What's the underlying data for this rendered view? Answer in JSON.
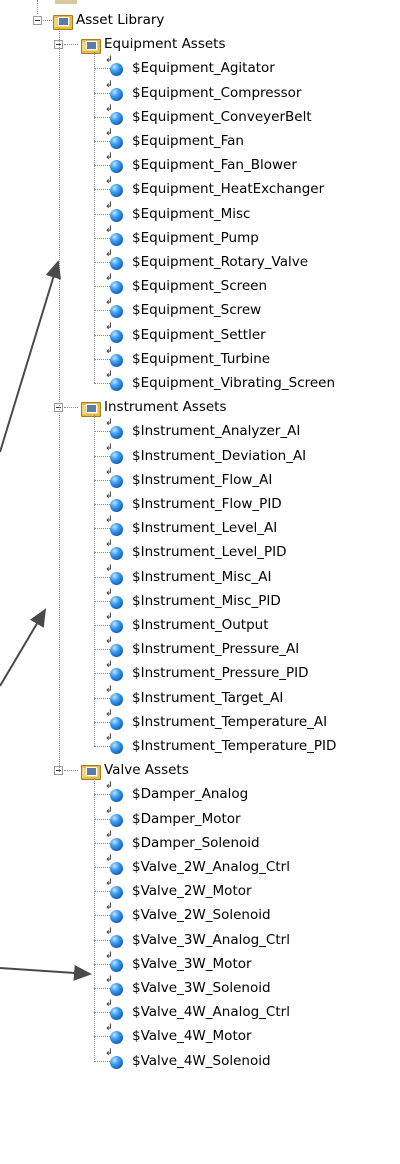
{
  "tree": {
    "root": {
      "label": "Asset Library"
    },
    "groups": [
      {
        "label": "Equipment Assets",
        "items": [
          "$Equipment_Agitator",
          "$Equipment_Compressor",
          "$Equipment_ConveyerBelt",
          "$Equipment_Fan",
          "$Equipment_Fan_Blower",
          "$Equipment_HeatExchanger",
          "$Equipment_Misc",
          "$Equipment_Pump",
          "$Equipment_Rotary_Valve",
          "$Equipment_Screen",
          "$Equipment_Screw",
          "$Equipment_Settler",
          "$Equipment_Turbine",
          "$Equipment_Vibrating_Screen"
        ]
      },
      {
        "label": "Instrument Assets",
        "items": [
          "$Instrument_Analyzer_AI",
          "$Instrument_Deviation_AI",
          "$Instrument_Flow_AI",
          "$Instrument_Flow_PID",
          "$Instrument_Level_AI",
          "$Instrument_Level_PID",
          "$Instrument_Misc_AI",
          "$Instrument_Misc_PID",
          "$Instrument_Output",
          "$Instrument_Pressure_AI",
          "$Instrument_Pressure_PID",
          "$Instrument_Target_AI",
          "$Instrument_Temperature_AI",
          "$Instrument_Temperature_PID"
        ]
      },
      {
        "label": "Valve Assets",
        "items": [
          "$Damper_Analog",
          "$Damper_Motor",
          "$Damper_Solenoid",
          "$Valve_2W_Analog_Ctrl",
          "$Valve_2W_Motor",
          "$Valve_2W_Solenoid",
          "$Valve_3W_Analog_Ctrl",
          "$Valve_3W_Motor",
          "$Valve_3W_Solenoid",
          "$Valve_4W_Analog_Ctrl",
          "$Valve_4W_Motor",
          "$Valve_4W_Solenoid"
        ]
      }
    ]
  },
  "icons": {
    "root": "asset-library-folder-icon",
    "group": "folder-icon",
    "item": "asset-sphere-icon",
    "toggle": "collapse-minus-icon"
  },
  "colors": {
    "arrow": "#4a4a4a",
    "connector": "#8a8a8a",
    "sphere": "#2a86e0"
  }
}
